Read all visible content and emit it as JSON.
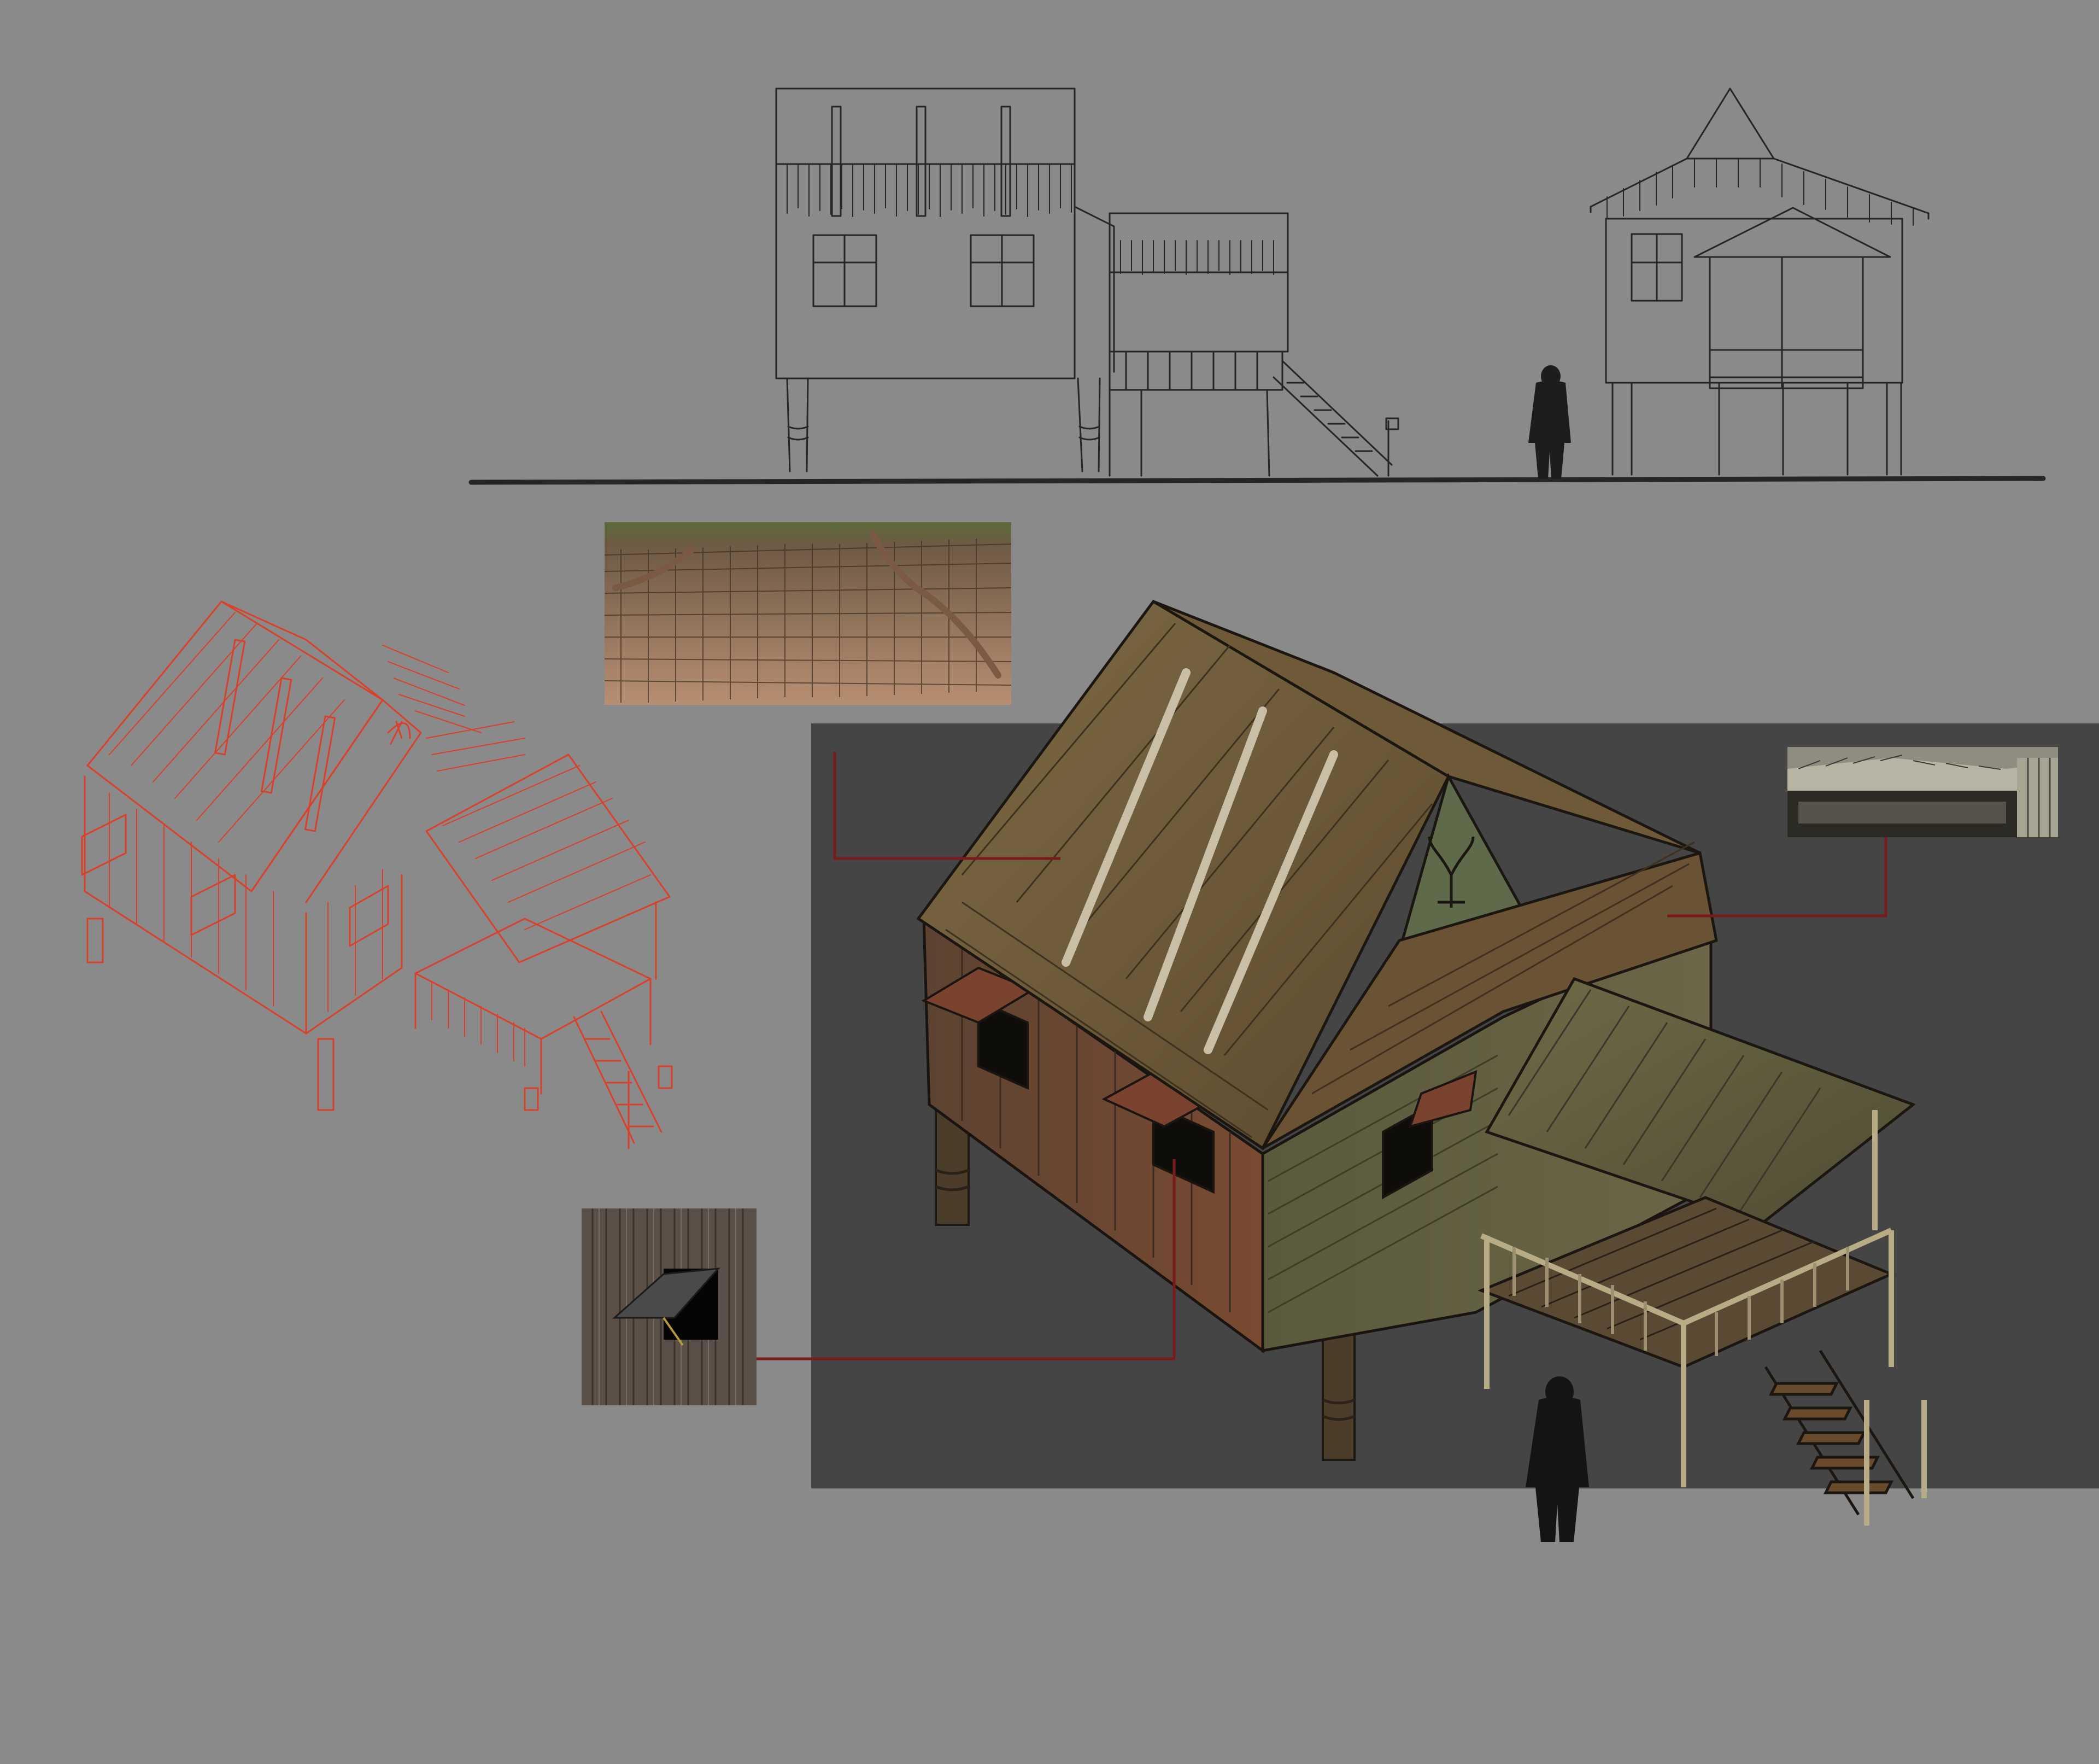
{
  "artboard": {
    "background_color": "#8a8a8a",
    "panel_color": "#454545",
    "sketch_line_color": "#2a2a2a",
    "red_sketch_color": "#d9412b",
    "callout_line_color": "#7a1a1a"
  },
  "elevations": {
    "side_view": "side-elevation-sketch",
    "front_view": "front-elevation-sketch",
    "scale_figure": "person-silhouette"
  },
  "reference_photos": [
    {
      "subject": "thatched-roof-texture"
    },
    {
      "subject": "wooden-wall-awning-window"
    },
    {
      "subject": "old-thatched-roof-house"
    }
  ],
  "icons": [
    "person-silhouette-icon",
    "totem-symbol-icon"
  ]
}
